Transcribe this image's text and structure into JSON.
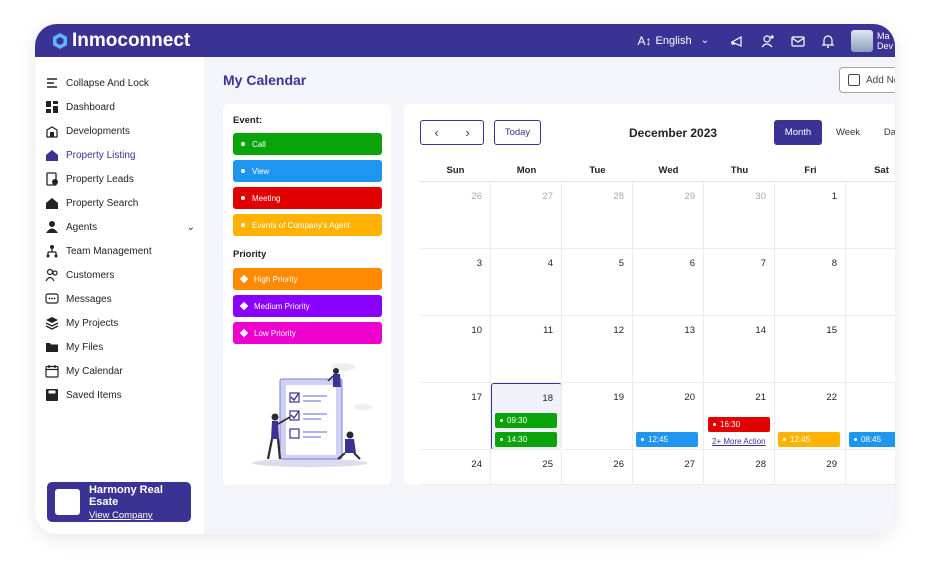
{
  "app": {
    "name": "Inmoconnect"
  },
  "topbar": {
    "language": "English",
    "user_name_line1": "Ma",
    "user_name_line2": "Dev"
  },
  "sidebar": {
    "items": [
      {
        "label": "Collapse And Lock",
        "icon": "collapse-icon"
      },
      {
        "label": "Dashboard",
        "icon": "dashboard-icon"
      },
      {
        "label": "Developments",
        "icon": "building-icon"
      },
      {
        "label": "Property Listing",
        "icon": "house-icon",
        "active": true
      },
      {
        "label": "Property Leads",
        "icon": "leads-icon"
      },
      {
        "label": "Property Search",
        "icon": "house-search-icon"
      },
      {
        "label": "Agents",
        "icon": "agents-icon",
        "expandable": true
      },
      {
        "label": "Team Management",
        "icon": "team-icon"
      },
      {
        "label": "Customers",
        "icon": "customers-icon"
      },
      {
        "label": "Messages",
        "icon": "messages-icon"
      },
      {
        "label": "My Projects",
        "icon": "layers-icon"
      },
      {
        "label": "My Files",
        "icon": "folder-icon"
      },
      {
        "label": "My Calendar",
        "icon": "calendar-icon"
      },
      {
        "label": "Saved Items",
        "icon": "save-icon"
      }
    ],
    "company": {
      "name": "Harmony Real Esate",
      "link": "View Company"
    }
  },
  "page": {
    "title": "My Calendar",
    "add_button": "Add Ne"
  },
  "legend": {
    "event_title": "Event:",
    "events": [
      {
        "label": "Call",
        "color": "#0aa40a"
      },
      {
        "label": "View",
        "color": "#1e96f0"
      },
      {
        "label": "Meeting",
        "color": "#e00000"
      },
      {
        "label": "Events of Company's Agent",
        "color": "#ffb300"
      }
    ],
    "priority_title": "Priority",
    "priorities": [
      {
        "label": "High Priority",
        "color": "#ff8a00"
      },
      {
        "label": "Medium Priority",
        "color": "#8a00ff"
      },
      {
        "label": "Low Priority",
        "color": "#ee00cc"
      }
    ]
  },
  "calendar": {
    "today_label": "Today",
    "month_title": "December 2023",
    "views": [
      "Month",
      "Week",
      "Da"
    ],
    "days_of_week": [
      "Sun",
      "Mon",
      "Tue",
      "Wed",
      "Thu",
      "Fri",
      "Sat"
    ],
    "weeks": [
      [
        "26",
        "27",
        "28",
        "29",
        "30",
        "1",
        ""
      ],
      [
        "3",
        "4",
        "5",
        "6",
        "7",
        "8",
        ""
      ],
      [
        "10",
        "11",
        "12",
        "13",
        "14",
        "15",
        ""
      ],
      [
        "17",
        "18",
        "19",
        "20",
        "21",
        "22",
        ""
      ],
      [
        "24",
        "25",
        "26",
        "27",
        "28",
        "29",
        ""
      ]
    ],
    "events": {
      "mon_18_a": "09:30",
      "mon_18_b": "14:30",
      "wed_20": "12:45",
      "thu_21": "16:30",
      "thu_21_more": "2+ More Action",
      "fri_22": "12:45",
      "sat_23": "08:45"
    }
  }
}
